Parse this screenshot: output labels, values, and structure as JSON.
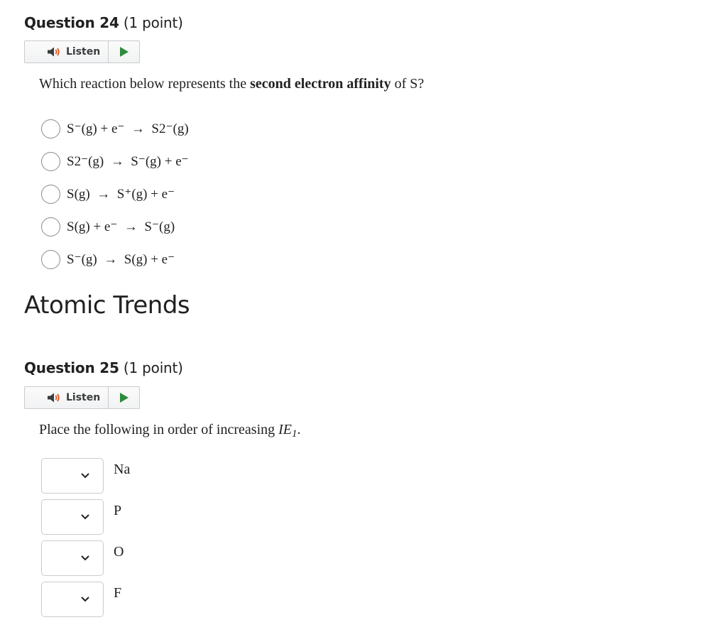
{
  "q24": {
    "number": "Question 24",
    "points": "(1 point)",
    "listen_label": "Listen",
    "prompt_pre": "Which reaction below represents the ",
    "prompt_bold": "second electron affinity",
    "prompt_post": " of S?",
    "options": [
      "S⁻(g) + e⁻  →  S2⁻(g)",
      "S2⁻(g)  →  S⁻(g) + e⁻",
      "S(g)  →  S⁺(g) + e⁻",
      "S(g) + e⁻  →  S⁻(g)",
      "S⁻(g)  →  S(g) + e⁻"
    ]
  },
  "section": {
    "title": "Atomic Trends"
  },
  "q25": {
    "number": "Question 25",
    "points": "(1 point)",
    "listen_label": "Listen",
    "prompt_pre": "Place the following in order of increasing ",
    "prompt_var": "IE",
    "prompt_sub": "1",
    "prompt_post": ".",
    "items": [
      "Na",
      "P",
      "O",
      "F"
    ]
  },
  "colors": {
    "play_icon": "#2e8b3c",
    "speaker_icon": "#3b3c3e",
    "speaker_waves": "#e0531f"
  },
  "icons": {
    "speaker": "speaker-icon",
    "play": "play-icon",
    "chevron": "chevron-down-icon"
  }
}
